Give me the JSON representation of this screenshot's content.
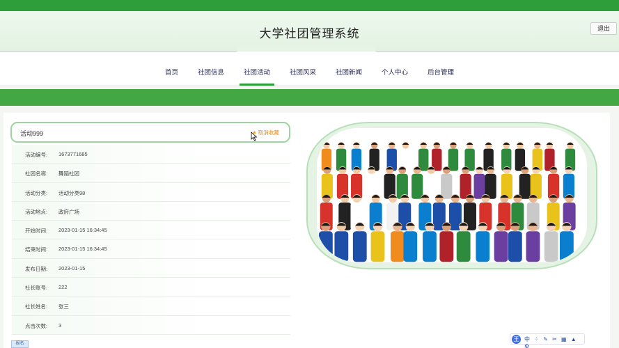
{
  "app": {
    "title": "大学社团管理系统",
    "logout_label": "退出"
  },
  "nav": {
    "items": [
      {
        "label": "首页"
      },
      {
        "label": "社团信息"
      },
      {
        "label": "社团活动"
      },
      {
        "label": "社团风采"
      },
      {
        "label": "社团新闻"
      },
      {
        "label": "个人中心"
      },
      {
        "label": "后台管理"
      }
    ],
    "active_index": 2
  },
  "activity": {
    "name": "活动999",
    "fav_label": "取消收藏",
    "fields": [
      {
        "label": "活动编号:",
        "value": "1673771685"
      },
      {
        "label": "社团名称:",
        "value": "舞蹈社团"
      },
      {
        "label": "活动分类:",
        "value": "活动分类98"
      },
      {
        "label": "活动地点:",
        "value": "政府广场"
      },
      {
        "label": "开始时间:",
        "value": "2023-01-15 16:34:45"
      },
      {
        "label": "结束时间:",
        "value": "2023-01-15 16:34:45"
      },
      {
        "label": "发布日期:",
        "value": "2023-01-15"
      },
      {
        "label": "社长账号:",
        "value": "222"
      },
      {
        "label": "社长姓名:",
        "value": "张三"
      },
      {
        "label": "点击次数:",
        "value": "3"
      }
    ],
    "bottom_button_label": "报名"
  },
  "ime_toolbar": {
    "badge": "王",
    "items": "中 ⁘ ✎ ✂ ▦ ▲ ⚙"
  },
  "icons": {
    "favorite": "star-icon",
    "cursor": "cursor-icon"
  },
  "colors": {
    "brand_green": "#2e9e3a",
    "accent_orange": "#e88b1a"
  }
}
